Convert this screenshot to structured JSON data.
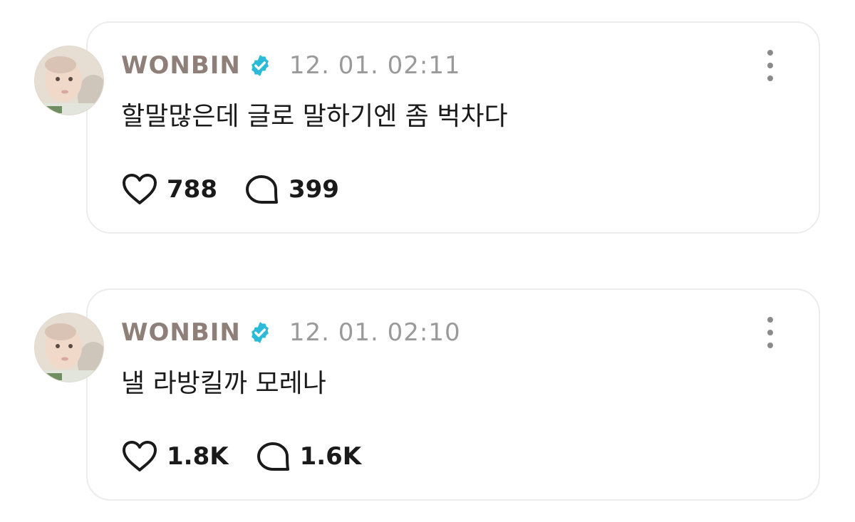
{
  "posts": [
    {
      "author": "WONBIN",
      "verified": true,
      "timestamp": "12. 01. 02:11",
      "text": "할말많은데 글로 말하기엔 좀 벅차다",
      "likes": "788",
      "replies": "399"
    },
    {
      "author": "WONBIN",
      "verified": true,
      "timestamp": "12. 01. 02:10",
      "text": "낼 라방킬까 모레나",
      "likes": "1.8K",
      "replies": "1.6K"
    }
  ],
  "icons": {
    "verified": "verified-badge-icon",
    "like": "heart-icon",
    "reply": "speech-bubble-icon",
    "more": "more-vertical-icon"
  },
  "colors": {
    "author": "#8f7f79",
    "verified": "#2bbbd8",
    "timestamp": "#9a9a9a",
    "card_border": "#ececec"
  }
}
